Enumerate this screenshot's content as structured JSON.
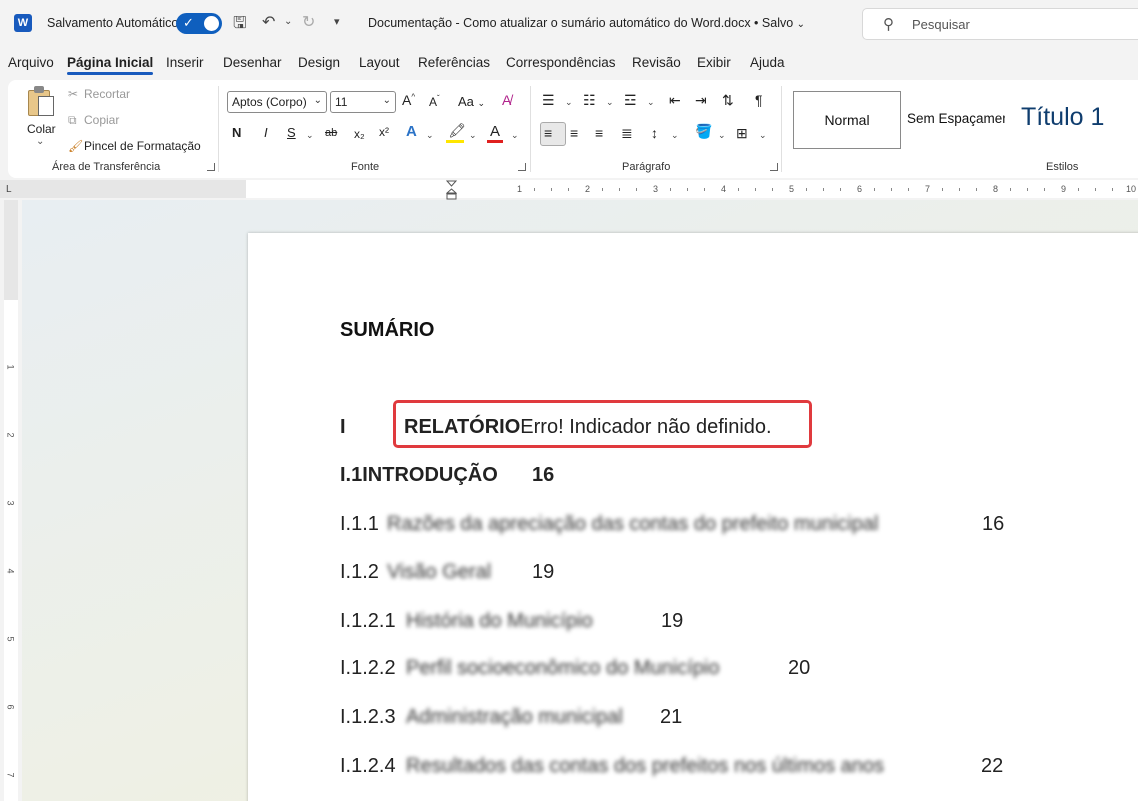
{
  "titlebar": {
    "app_icon_letter": "W",
    "autosave_label": "Salvamento Automático",
    "doc_title": "Documentação - Como atualizar o sumário automático do Word.docx • Salvo",
    "search_placeholder": "Pesquisar"
  },
  "menu": {
    "tabs": [
      "Arquivo",
      "Página Inicial",
      "Inserir",
      "Desenhar",
      "Design",
      "Layout",
      "Referências",
      "Correspondências",
      "Revisão",
      "Exibir",
      "Ajuda"
    ],
    "active": "Página Inicial"
  },
  "ribbon": {
    "clipboard": {
      "paste": "Colar",
      "cut": "Recortar",
      "copy": "Copiar",
      "format_painter": "Pincel de Formatação",
      "label": "Área de Transferência"
    },
    "font": {
      "family": "Aptos (Corpo)",
      "size": "11",
      "bold": "N",
      "italic": "I",
      "underline": "S",
      "strikethrough": "ab",
      "subscript": "x₂",
      "superscript": "x²",
      "text_effects": "A",
      "case": "Aa",
      "grow": "A",
      "shrink": "A",
      "font_color": "A",
      "label": "Fonte",
      "highlight_color": "#ffe600",
      "font_color_value": "#e0201f"
    },
    "paragraph": {
      "label": "Parágrafo",
      "pilcrow": "¶"
    },
    "styles": {
      "normal": "Normal",
      "no_spacing": "Sem Espaçamento",
      "heading1": "Título 1",
      "label": "Estilos"
    }
  },
  "ruler": {
    "marks": [
      "1",
      "1",
      "2",
      "3",
      "4",
      "5",
      "6",
      "7",
      "8",
      "9",
      "10"
    ],
    "vertical_marks": [
      "1",
      "1",
      "2",
      "3",
      "4",
      "5",
      "6",
      "7"
    ],
    "corner": "L"
  },
  "document": {
    "heading": "SUMÁRIO",
    "toc": [
      {
        "num": "I",
        "title": "RELATÓRIO",
        "note": "Erro! Indicador não definido."
      },
      {
        "num": "I.1",
        "title": "INTRODUÇÃO",
        "page": "16"
      },
      {
        "num": "I.1.1",
        "title": "Razões da apreciação das contas do prefeito municipal",
        "page": "16"
      },
      {
        "num": "I.1.2",
        "title": "Visão Geral",
        "page": "19"
      },
      {
        "num": "I.1.2.1",
        "title": "História do Município",
        "page": "19"
      },
      {
        "num": "I.1.2.2",
        "title": "Perfil socioeconômico do Município",
        "page": "20"
      },
      {
        "num": "I.1.2.3",
        "title": "Administração municipal",
        "page": "21"
      },
      {
        "num": "I.1.2.4",
        "title": "Resultados das contas dos prefeitos nos últimos anos",
        "page": "22"
      }
    ]
  },
  "colors": {
    "accent": "#185abd",
    "error_outline": "#e03a3e"
  }
}
